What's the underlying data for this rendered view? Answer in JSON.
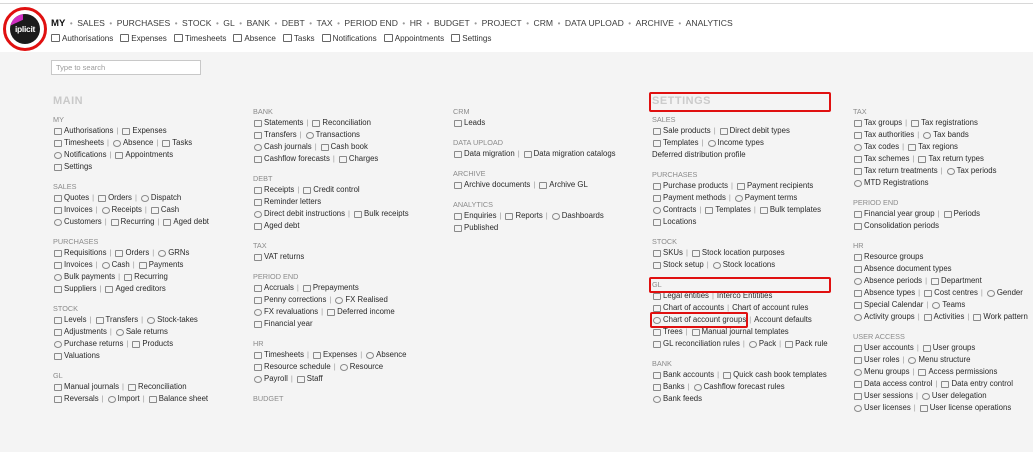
{
  "logo": {
    "text": "iplicit",
    "flag": "ai"
  },
  "main_nav": [
    "MY",
    "SALES",
    "PURCHASES",
    "STOCK",
    "GL",
    "BANK",
    "DEBT",
    "TAX",
    "PERIOD END",
    "HR",
    "BUDGET",
    "PROJECT",
    "CRM",
    "DATA UPLOAD",
    "ARCHIVE",
    "ANALYTICS"
  ],
  "sub_nav": [
    {
      "label": "Authorisations",
      "icon": "chat-icon"
    },
    {
      "label": "Expenses",
      "icon": "card-icon"
    },
    {
      "label": "Timesheets",
      "icon": "people-icon"
    },
    {
      "label": "Absence",
      "icon": "person-icon"
    },
    {
      "label": "Tasks",
      "icon": "check-icon"
    },
    {
      "label": "Notifications",
      "icon": "flag-icon"
    },
    {
      "label": "Appointments",
      "icon": "calendar-icon"
    },
    {
      "label": "Settings",
      "icon": "gear-icon"
    }
  ],
  "search": {
    "placeholder": "Type to search"
  },
  "col1": {
    "title": "MAIN",
    "sections": [
      {
        "title": "MY",
        "rows": [
          [
            "Authorisations",
            "Expenses"
          ],
          [
            "Timesheets",
            "Absence",
            "Tasks"
          ],
          [
            "Notifications",
            "Appointments"
          ],
          [
            "Settings"
          ]
        ]
      },
      {
        "title": "SALES",
        "rows": [
          [
            "Quotes",
            "Orders",
            "Dispatch"
          ],
          [
            "Invoices",
            "Receipts",
            "Cash"
          ],
          [
            "Customers",
            "Recurring",
            "Aged debt"
          ]
        ]
      },
      {
        "title": "PURCHASES",
        "rows": [
          [
            "Requisitions",
            "Orders",
            "GRNs"
          ],
          [
            "Invoices",
            "Cash",
            "Payments"
          ],
          [
            "Bulk payments",
            "Recurring"
          ],
          [
            "Suppliers",
            "Aged creditors"
          ]
        ]
      },
      {
        "title": "STOCK",
        "rows": [
          [
            "Levels",
            "Transfers",
            "Stock-takes"
          ],
          [
            "Adjustments",
            "Sale returns"
          ],
          [
            "Purchase returns",
            "Products"
          ],
          [
            "Valuations"
          ]
        ]
      },
      {
        "title": "GL",
        "rows": [
          [
            "Manual journals",
            "Reconciliation"
          ],
          [
            "Reversals",
            "Import",
            "Balance sheet"
          ]
        ]
      }
    ]
  },
  "col2": {
    "sections": [
      {
        "title": "BANK",
        "rows": [
          [
            "Statements",
            "Reconciliation"
          ],
          [
            "Transfers",
            "Transactions"
          ],
          [
            "Cash journals",
            "Cash book"
          ],
          [
            "Cashflow forecasts",
            "Charges"
          ]
        ]
      },
      {
        "title": "DEBT",
        "rows": [
          [
            "Receipts",
            "Credit control"
          ],
          [
            "Reminder letters"
          ],
          [
            "Direct debit instructions",
            "Bulk receipts"
          ],
          [
            "Aged debt"
          ]
        ]
      },
      {
        "title": "TAX",
        "rows": [
          [
            "VAT returns"
          ]
        ]
      },
      {
        "title": "PERIOD END",
        "rows": [
          [
            "Accruals",
            "Prepayments"
          ],
          [
            "Penny corrections",
            "FX Realised"
          ],
          [
            "FX revaluations",
            "Deferred income"
          ],
          [
            "Financial year"
          ]
        ]
      },
      {
        "title": "HR",
        "rows": [
          [
            "Timesheets",
            "Expenses",
            "Absence"
          ],
          [
            "Resource schedule",
            "Resource"
          ],
          [
            "Payroll",
            "Staff"
          ]
        ]
      },
      {
        "title": "BUDGET",
        "rows": []
      }
    ]
  },
  "col3": {
    "sections": [
      {
        "title": "CRM",
        "rows": [
          [
            "Leads"
          ]
        ]
      },
      {
        "title": "DATA UPLOAD",
        "rows": [
          [
            "Data migration",
            "Data migration catalogs"
          ]
        ]
      },
      {
        "title": "ARCHIVE",
        "rows": [
          [
            "Archive documents",
            "Archive GL"
          ]
        ]
      },
      {
        "title": "ANALYTICS",
        "rows": [
          [
            "Enquiries",
            "Reports",
            "Dashboards"
          ],
          [
            "Published"
          ]
        ]
      }
    ]
  },
  "col4": {
    "title": "SETTINGS",
    "sections": [
      {
        "title": "SALES",
        "rows": [
          [
            "Sale products",
            "Direct debit types"
          ],
          [
            "Templates",
            "Income types"
          ],
          [
            "Deferred distribution profile"
          ]
        ]
      },
      {
        "title": "PURCHASES",
        "rows": [
          [
            "Purchase products",
            "Payment recipients"
          ],
          [
            "Payment methods",
            "Payment terms"
          ],
          [
            "Contracts",
            "Templates",
            "Bulk templates"
          ],
          [
            "Locations"
          ]
        ]
      },
      {
        "title": "STOCK",
        "rows": [
          [
            "SKUs",
            "Stock location purposes"
          ],
          [
            "Stock setup",
            "Stock locations"
          ]
        ]
      },
      {
        "title": "GL",
        "rows": [
          [
            "Legal entities",
            "Interco Entitities"
          ],
          [
            "Chart of accounts",
            "Chart of account rules"
          ],
          [
            "Chart of account groups",
            "Account defaults"
          ],
          [
            "Trees",
            "Manual journal templates"
          ],
          [
            "GL reconciliation rules",
            "Pack",
            "Pack rule"
          ]
        ]
      },
      {
        "title": "BANK",
        "rows": [
          [
            "Bank accounts",
            "Quick cash book templates"
          ],
          [
            "Banks",
            "Cashflow forecast rules"
          ],
          [
            "Bank feeds"
          ]
        ]
      }
    ]
  },
  "col5": {
    "sections": [
      {
        "title": "TAX",
        "rows": [
          [
            "Tax groups",
            "Tax registrations"
          ],
          [
            "Tax authorities",
            "Tax bands"
          ],
          [
            "Tax codes",
            "Tax regions"
          ],
          [
            "Tax schemes",
            "Tax return types"
          ],
          [
            "Tax return treatments",
            "Tax periods"
          ],
          [
            "MTD Registrations"
          ]
        ]
      },
      {
        "title": "PERIOD END",
        "rows": [
          [
            "Financial year group",
            "Periods"
          ],
          [
            "Consolidation periods"
          ]
        ]
      },
      {
        "title": "HR",
        "rows": [
          [
            "Resource groups"
          ],
          [
            "Absence document types"
          ],
          [
            "Absence periods",
            "Department"
          ],
          [
            "Absence types",
            "Cost centres",
            "Gender"
          ],
          [
            "Special Calendar",
            "Teams"
          ],
          [
            "Activity groups",
            "Activities",
            "Work pattern"
          ]
        ]
      },
      {
        "title": "USER ACCESS",
        "rows": [
          [
            "User accounts",
            "User groups"
          ],
          [
            "User roles",
            "Menu structure"
          ],
          [
            "Menu groups",
            "Access permissions"
          ],
          [
            "Data access control",
            "Data entry control"
          ],
          [
            "User sessions",
            "User delegation"
          ],
          [
            "User licenses",
            "User license operations"
          ]
        ]
      }
    ]
  }
}
